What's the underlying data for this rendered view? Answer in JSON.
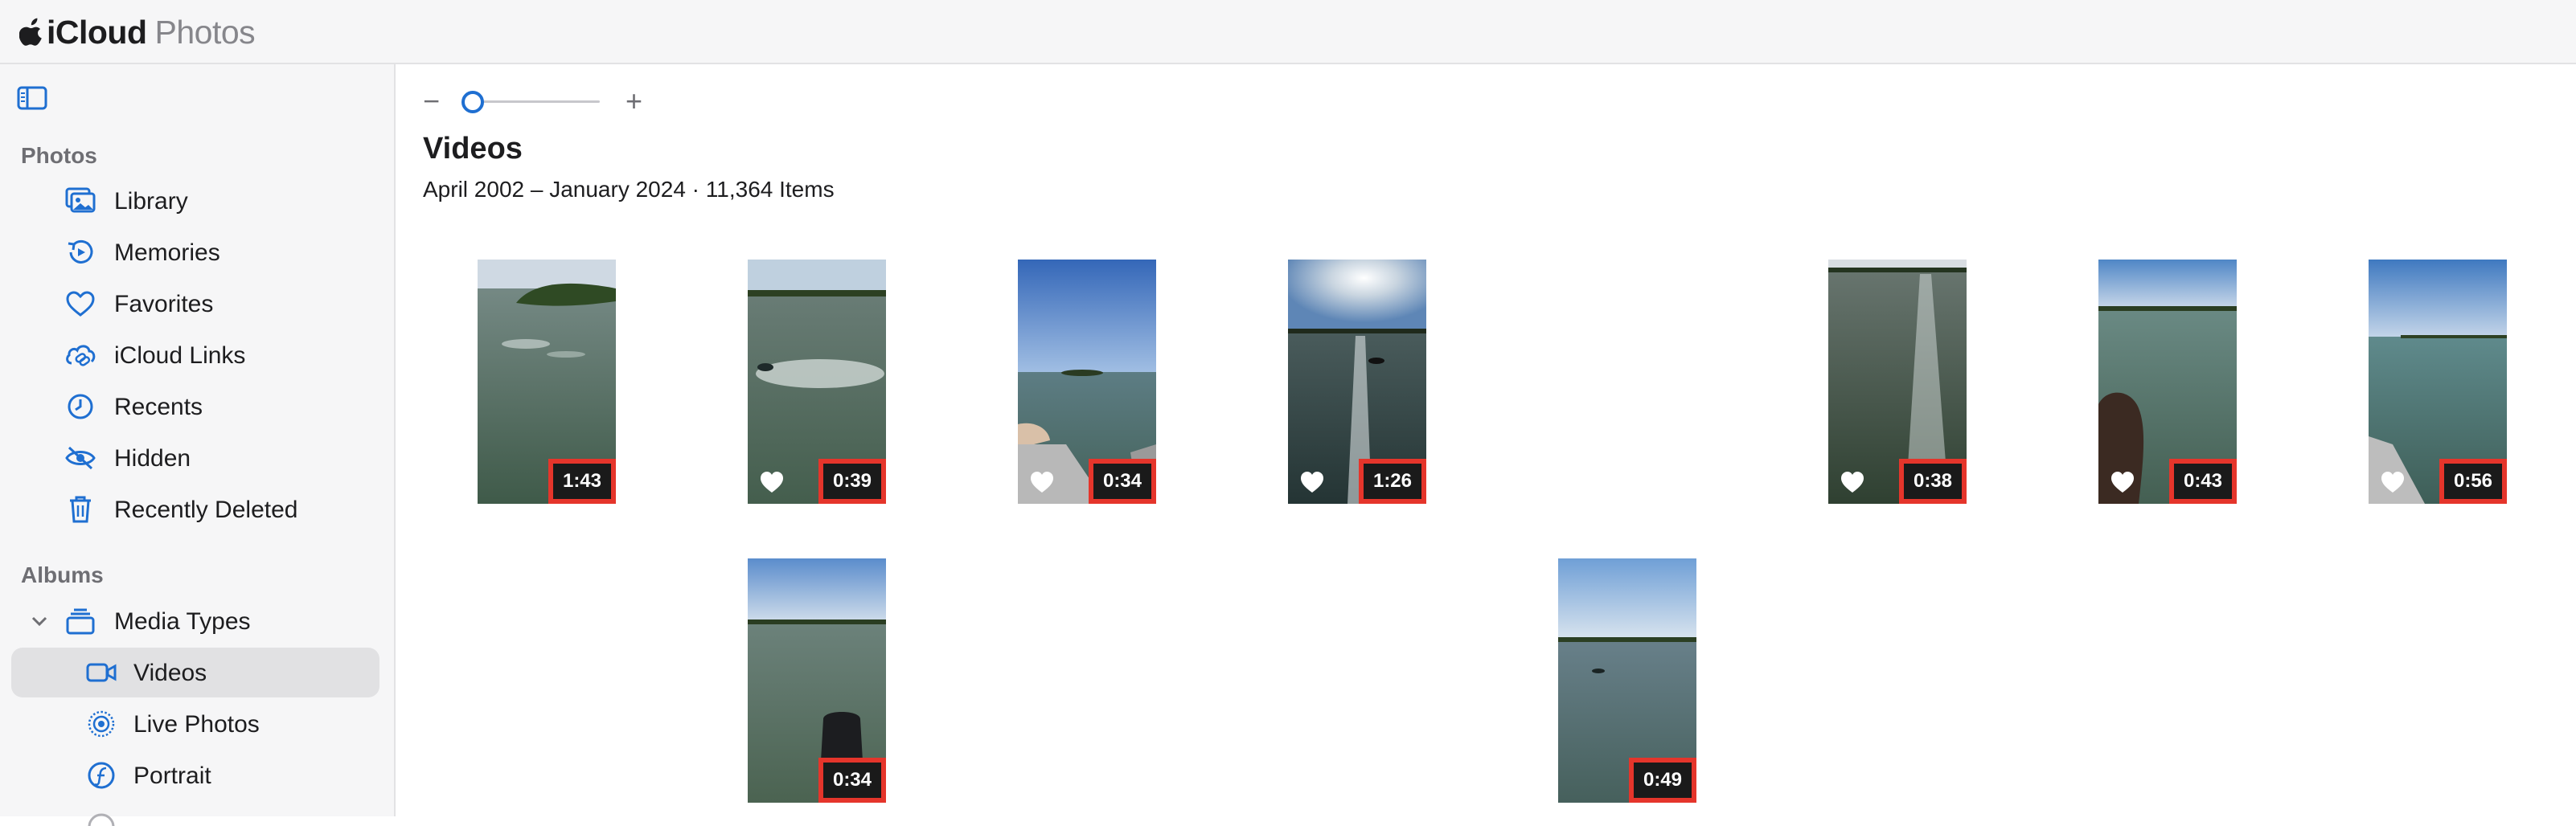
{
  "app": {
    "name_a": "iCloud",
    "name_b": "Photos"
  },
  "sidebar": {
    "section_photos": "Photos",
    "section_albums": "Albums",
    "photos_items": [
      {
        "label": "Library",
        "icon": "library-icon"
      },
      {
        "label": "Memories",
        "icon": "memories-icon"
      },
      {
        "label": "Favorites",
        "icon": "heart-icon"
      },
      {
        "label": "iCloud Links",
        "icon": "link-icon"
      },
      {
        "label": "Recents",
        "icon": "clock-icon"
      },
      {
        "label": "Hidden",
        "icon": "eye-slash-icon"
      },
      {
        "label": "Recently Deleted",
        "icon": "trash-icon"
      }
    ],
    "albums_items": [
      {
        "label": "Media Types",
        "icon": "stack-icon",
        "expanded": true
      },
      {
        "label": "Videos",
        "icon": "video-icon",
        "selected": true
      },
      {
        "label": "Live Photos",
        "icon": "live-photo-icon"
      },
      {
        "label": "Portrait",
        "icon": "portrait-icon"
      }
    ]
  },
  "main": {
    "title": "Videos",
    "subtitle": "April 2002 – January 2024  ·  11,364 Items",
    "zoom": {
      "minus": "−",
      "plus": "+",
      "level": 0
    },
    "videos": [
      {
        "duration": "1:43",
        "favorite": false
      },
      {
        "duration": "0:39",
        "favorite": true
      },
      {
        "duration": "0:34",
        "favorite": true
      },
      {
        "duration": "1:26",
        "favorite": true
      },
      {
        "duration": "0:38",
        "favorite": true
      },
      {
        "duration": "0:43",
        "favorite": true
      },
      {
        "duration": "0:56",
        "favorite": true
      },
      {
        "duration": "0:34",
        "favorite": false
      },
      {
        "duration": "0:49",
        "favorite": false
      }
    ]
  },
  "colors": {
    "accent": "#1f6fd1",
    "highlight_border": "#e5352b",
    "selected_bg": "#e1e1e3"
  }
}
